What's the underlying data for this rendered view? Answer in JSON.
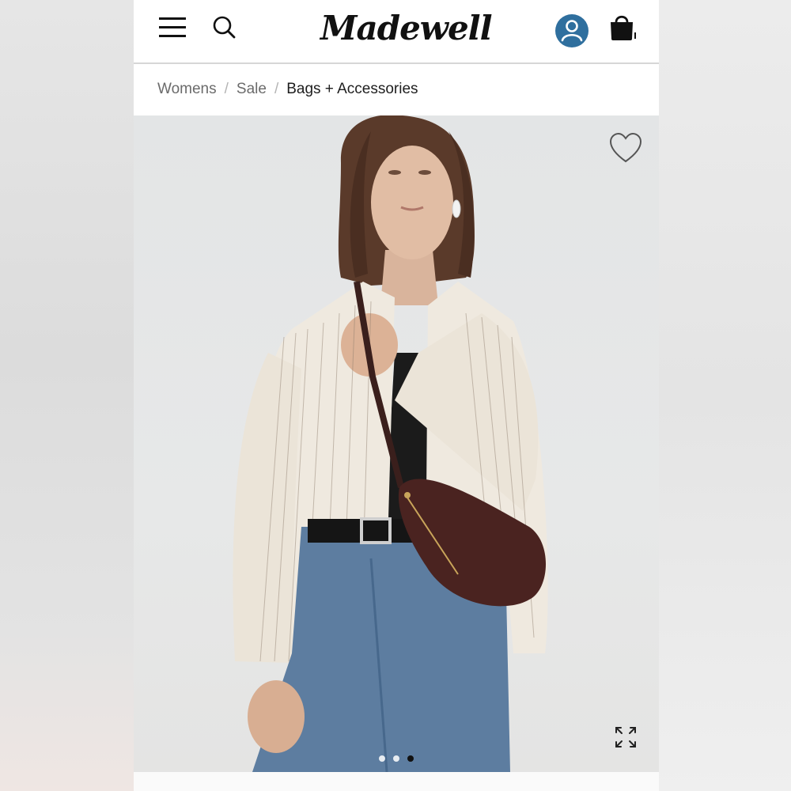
{
  "header": {
    "logo_text": "Madewell",
    "menu_icon": "hamburger-menu-icon",
    "search_icon": "search-icon",
    "account_icon": "account-icon",
    "account_color": "#2f6f9e",
    "bag_icon": "shopping-bag-icon"
  },
  "breadcrumb": {
    "items": [
      "Womens",
      "Sale",
      "Bags + Accessories"
    ],
    "separator": "/"
  },
  "product_image": {
    "wishlist_icon": "heart-icon",
    "expand_icon": "expand-icon",
    "carousel": {
      "count": 3,
      "active_index": 2
    }
  }
}
